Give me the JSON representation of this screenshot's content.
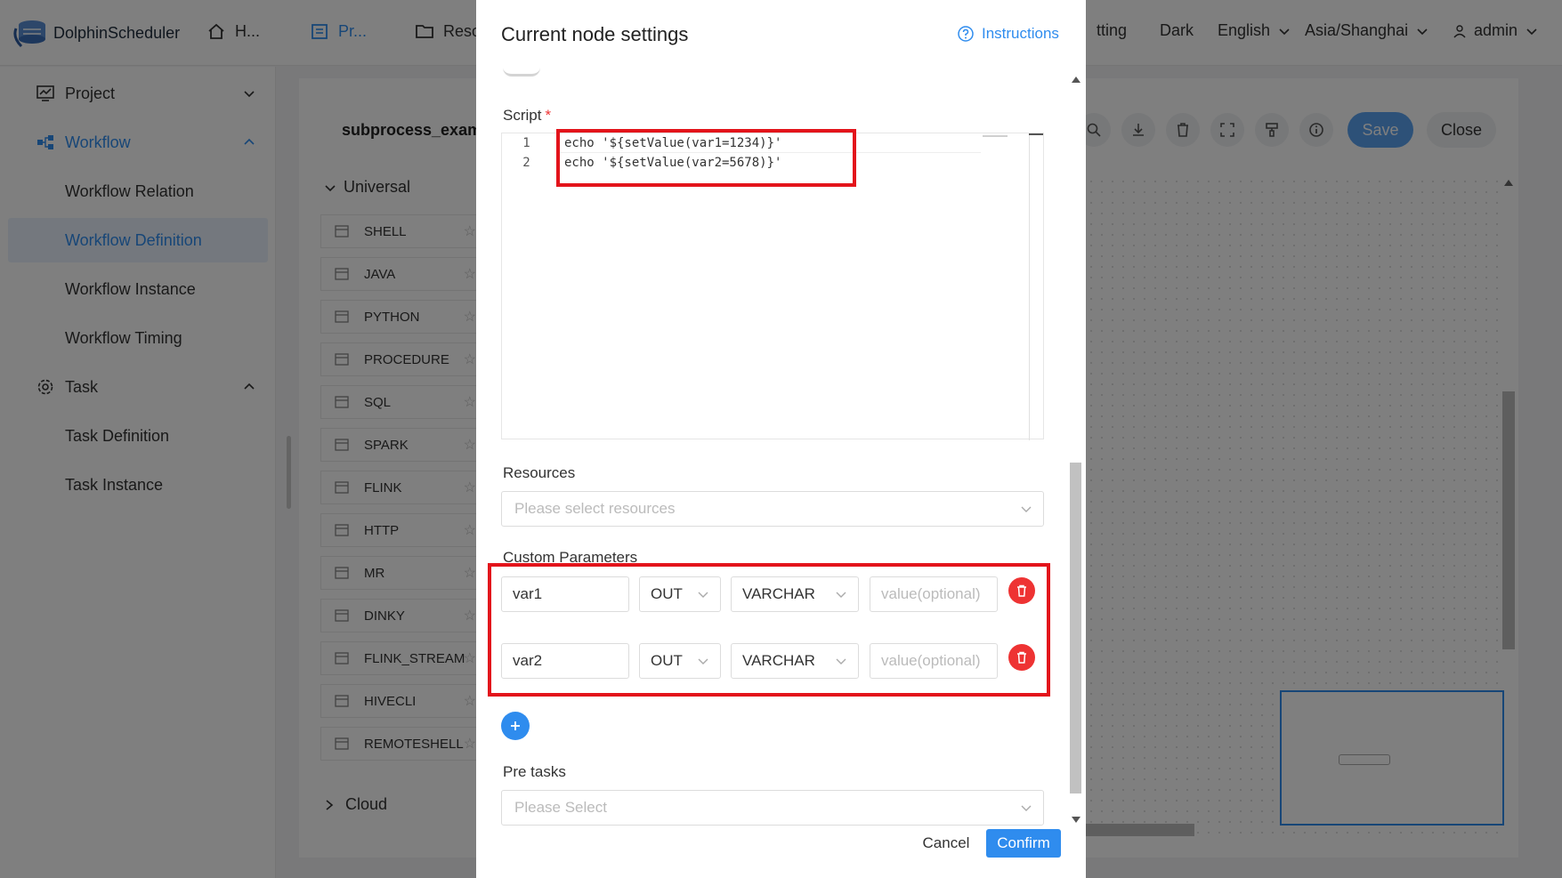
{
  "header": {
    "logo_text": "DolphinScheduler",
    "nav": [
      "H...",
      "Pr...",
      "Reso",
      "tting"
    ],
    "theme": "Dark",
    "language": "English",
    "timezone": "Asia/Shanghai",
    "user": "admin"
  },
  "sidebar": {
    "project": "Project",
    "workflow": "Workflow",
    "workflow_items": [
      "Workflow Relation",
      "Workflow Definition",
      "Workflow Instance",
      "Workflow Timing"
    ],
    "task": "Task",
    "task_items": [
      "Task Definition",
      "Task Instance"
    ]
  },
  "panel": {
    "title": "subprocess_examp",
    "category": "Universal",
    "tasks": [
      "SHELL",
      "JAVA",
      "PYTHON",
      "PROCEDURE",
      "SQL",
      "SPARK",
      "FLINK",
      "HTTP",
      "MR",
      "DINKY",
      "FLINK_STREAM",
      "HIVECLI",
      "REMOTESHELL"
    ],
    "cloud": "Cloud",
    "save": "Save",
    "close": "Close"
  },
  "drawer": {
    "title": "Current node settings",
    "instructions": "Instructions",
    "script_label": "Script",
    "required_mark": "*",
    "script_lines": [
      {
        "num": "1",
        "code": "echo '${setValue(var1=1234)}'"
      },
      {
        "num": "2",
        "code": "echo '${setValue(var2=5678)}'"
      }
    ],
    "resources_label": "Resources",
    "resources_placeholder": "Please select resources",
    "custom_params_label": "Custom Parameters",
    "params": [
      {
        "name": "var1",
        "direct": "OUT",
        "type": "VARCHAR",
        "value_placeholder": "value(optional)"
      },
      {
        "name": "var2",
        "direct": "OUT",
        "type": "VARCHAR",
        "value_placeholder": "value(optional)"
      }
    ],
    "pre_tasks_label": "Pre tasks",
    "pre_tasks_placeholder": "Please Select",
    "cancel": "Cancel",
    "confirm": "Confirm"
  },
  "colors": {
    "accent": "#2f8cee",
    "danger": "#e33333",
    "highlight": "#e3141b"
  }
}
